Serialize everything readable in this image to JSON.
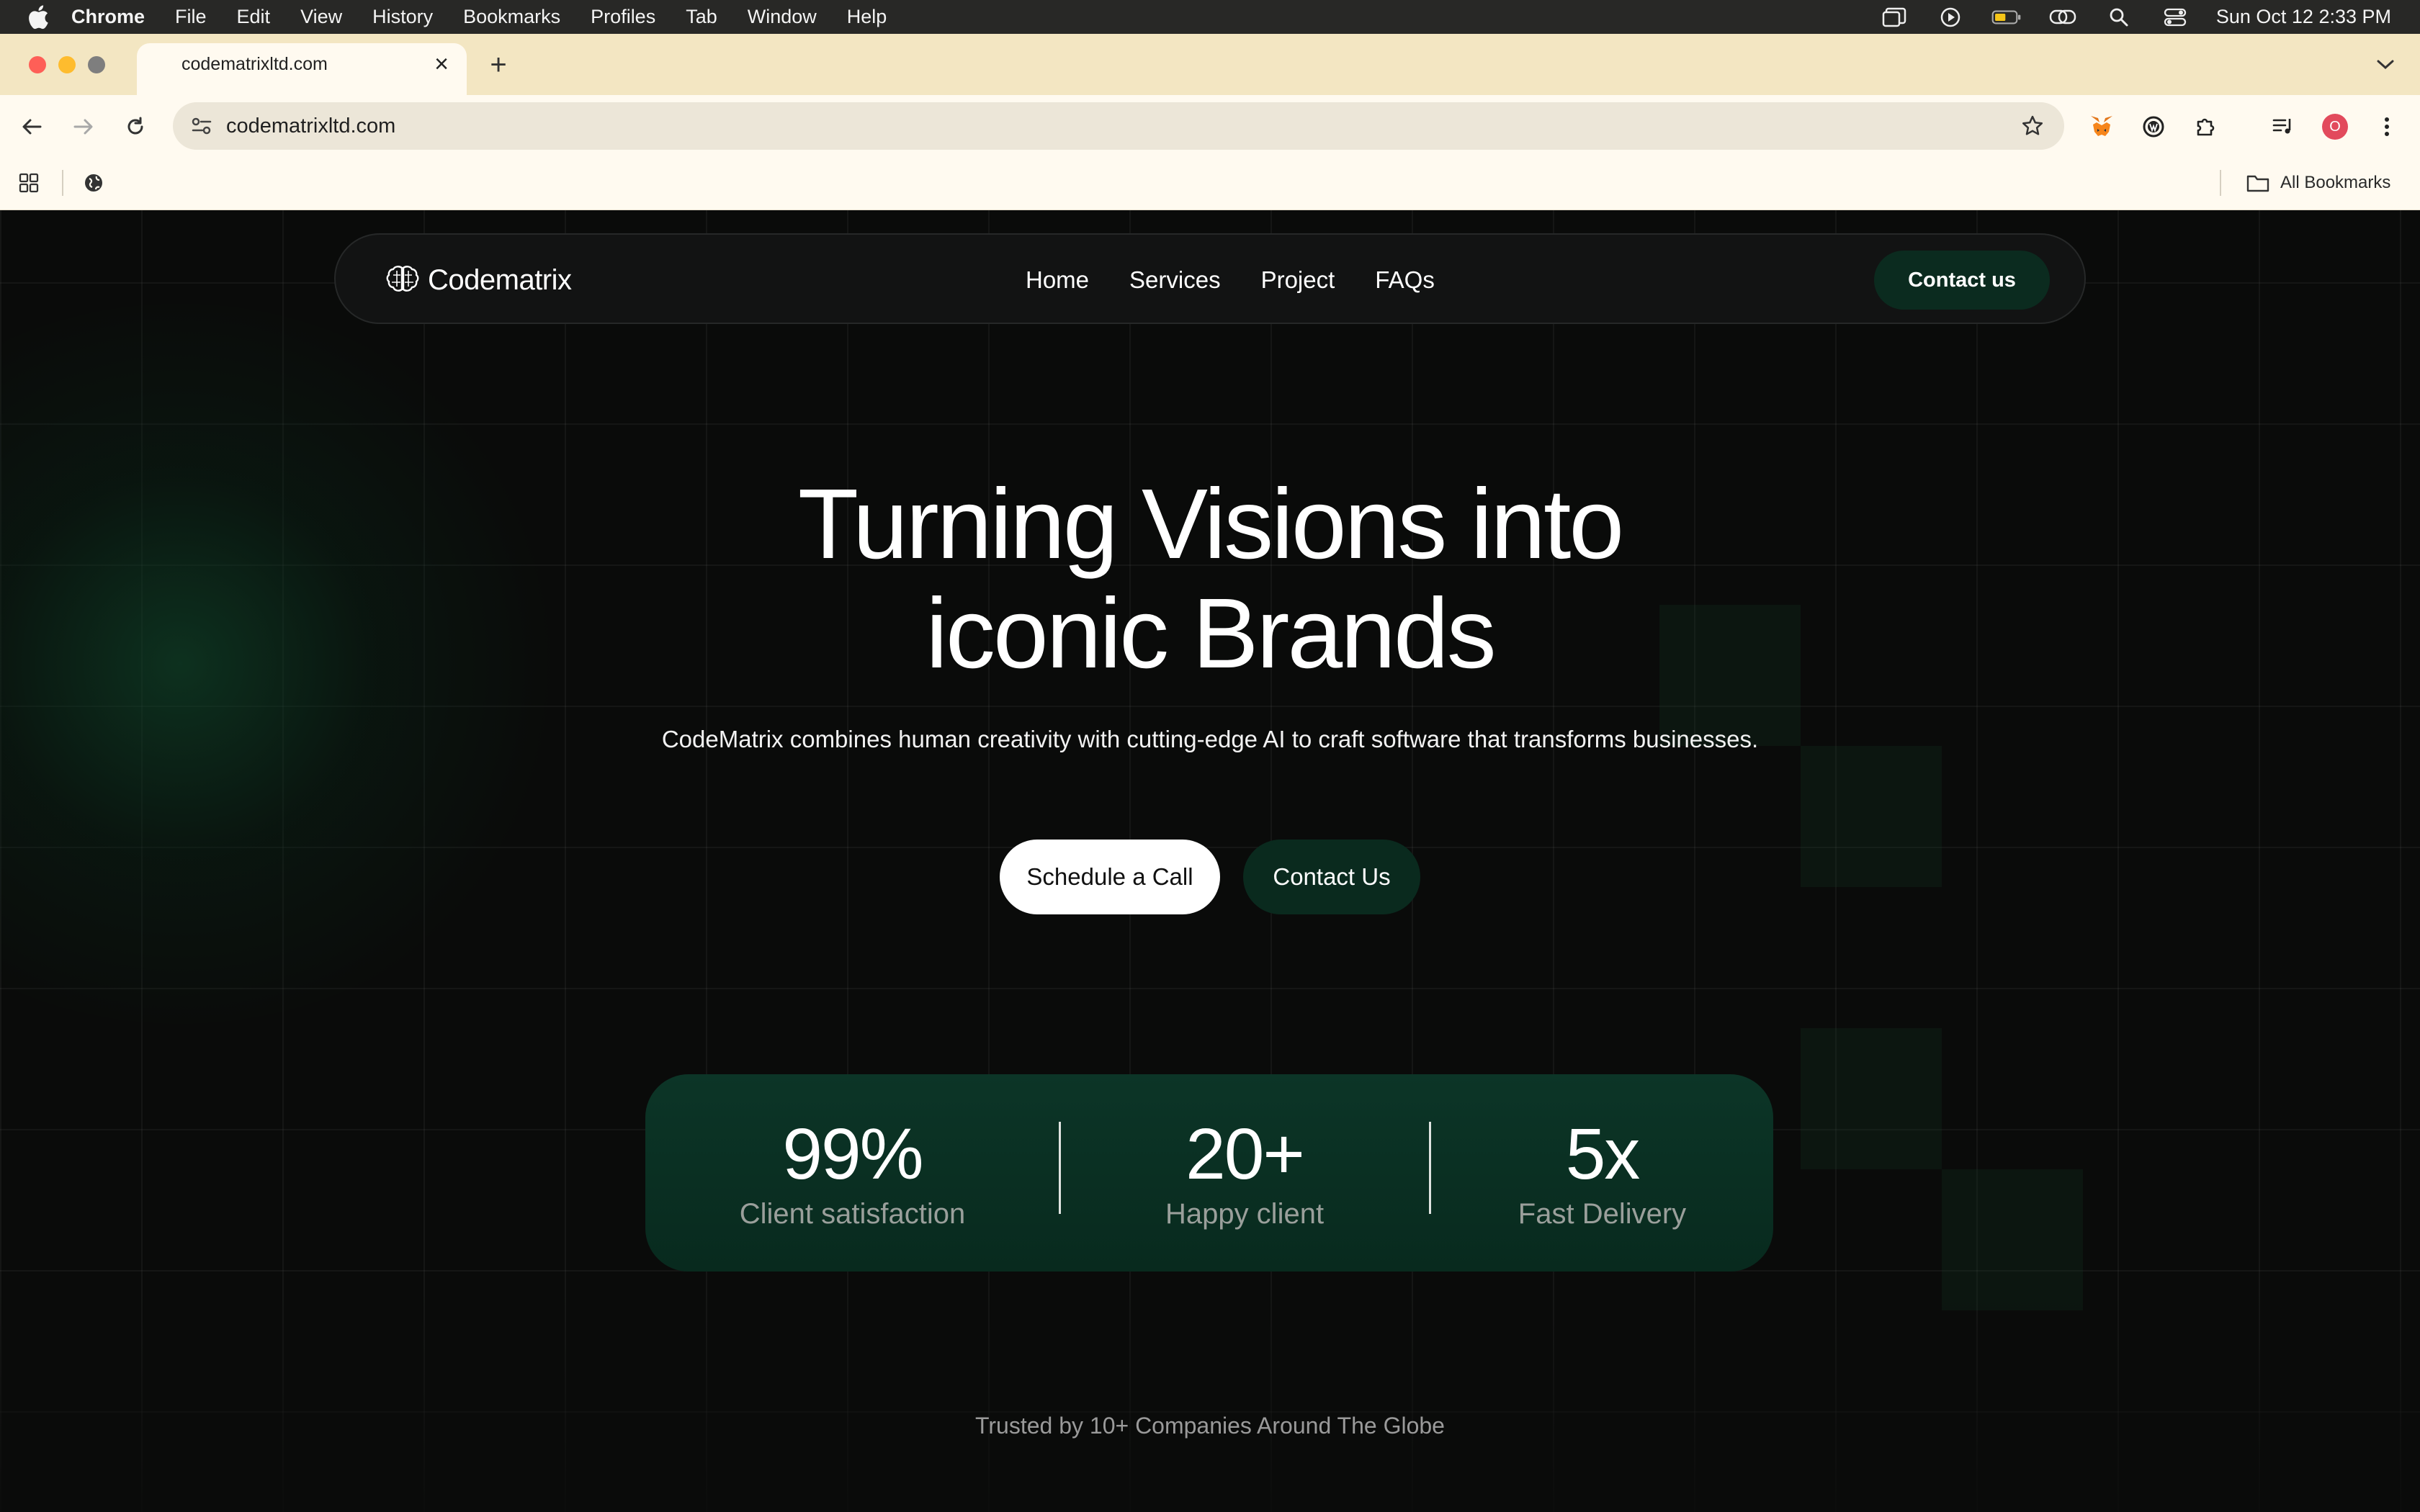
{
  "menubar": {
    "app": "Chrome",
    "items": [
      "File",
      "Edit",
      "View",
      "History",
      "Bookmarks",
      "Profiles",
      "Tab",
      "Window",
      "Help"
    ],
    "clock": "Sun Oct 12  2:33 PM"
  },
  "browser": {
    "tab_title": "codematrixltd.com",
    "url": "codematrixltd.com",
    "bookmarks_label": "All Bookmarks",
    "profile_initial": "O"
  },
  "site": {
    "logo": "Codematrix",
    "nav": [
      "Home",
      "Services",
      "Project",
      "FAQs"
    ],
    "nav_contact": "Contact us",
    "hero_line1": "Turning Visions into",
    "hero_line2": "iconic Brands",
    "hero_sub": "CodeMatrix combines human creativity with cutting-edge AI to craft software that transforms businesses.",
    "btn_primary": "Schedule a Call",
    "btn_secondary": "Contact Us",
    "stats": [
      {
        "value": "99%",
        "label": "Client satisfaction"
      },
      {
        "value": "20+",
        "label": "Happy client"
      },
      {
        "value": "5x",
        "label": "Fast Delivery"
      }
    ],
    "trusted": "Trusted by 10+ Companies Around The Globe"
  },
  "colors": {
    "accent_green": "#0b2b1f",
    "stats_bg": "#0c3527",
    "tabstrip": "#f3e6c2"
  }
}
